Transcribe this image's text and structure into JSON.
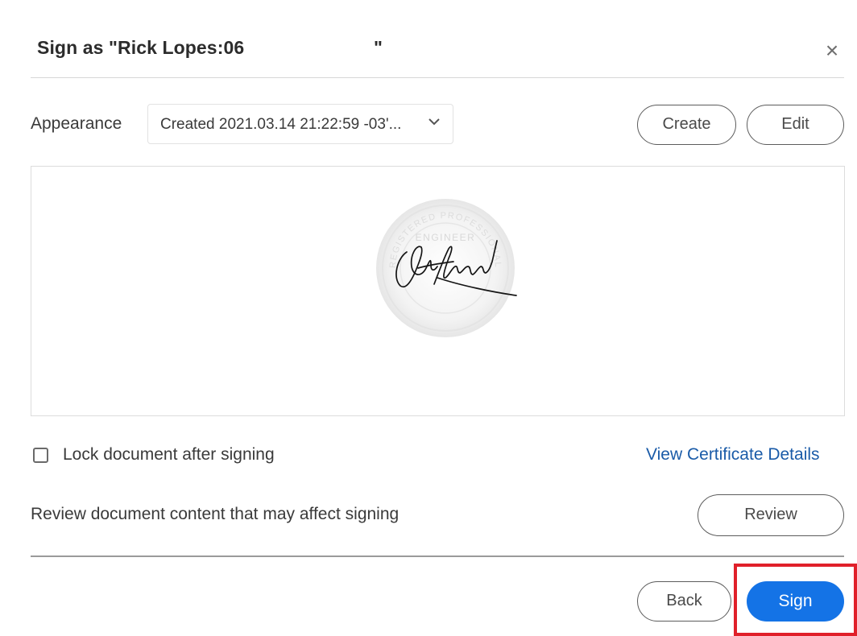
{
  "dialog": {
    "title_prefix": "Sign as \"Rick Lopes:06",
    "title_suffix": "\"",
    "close_icon": "close-icon"
  },
  "appearance": {
    "label": "Appearance",
    "selected": "Created 2021.03.14 21:22:59 -03'...",
    "chevron_icon": "chevron-down-icon"
  },
  "buttons": {
    "create": "Create",
    "edit": "Edit",
    "review": "Review",
    "back": "Back",
    "sign": "Sign"
  },
  "options": {
    "lock_label": "Lock document after signing",
    "lock_checked": false,
    "cert_link": "View Certificate Details",
    "review_text": "Review document content that may affect signing"
  },
  "preview": {
    "seal_text_top": "REGISTERED PROFESSIONAL",
    "seal_text_mid": "ENGINEER",
    "seal_icon": "engineer-seal-icon",
    "signature_icon": "handwritten-signature-icon"
  },
  "colors": {
    "primary": "#1473e6",
    "link": "#1a5ba8",
    "highlight": "#e0202a"
  }
}
